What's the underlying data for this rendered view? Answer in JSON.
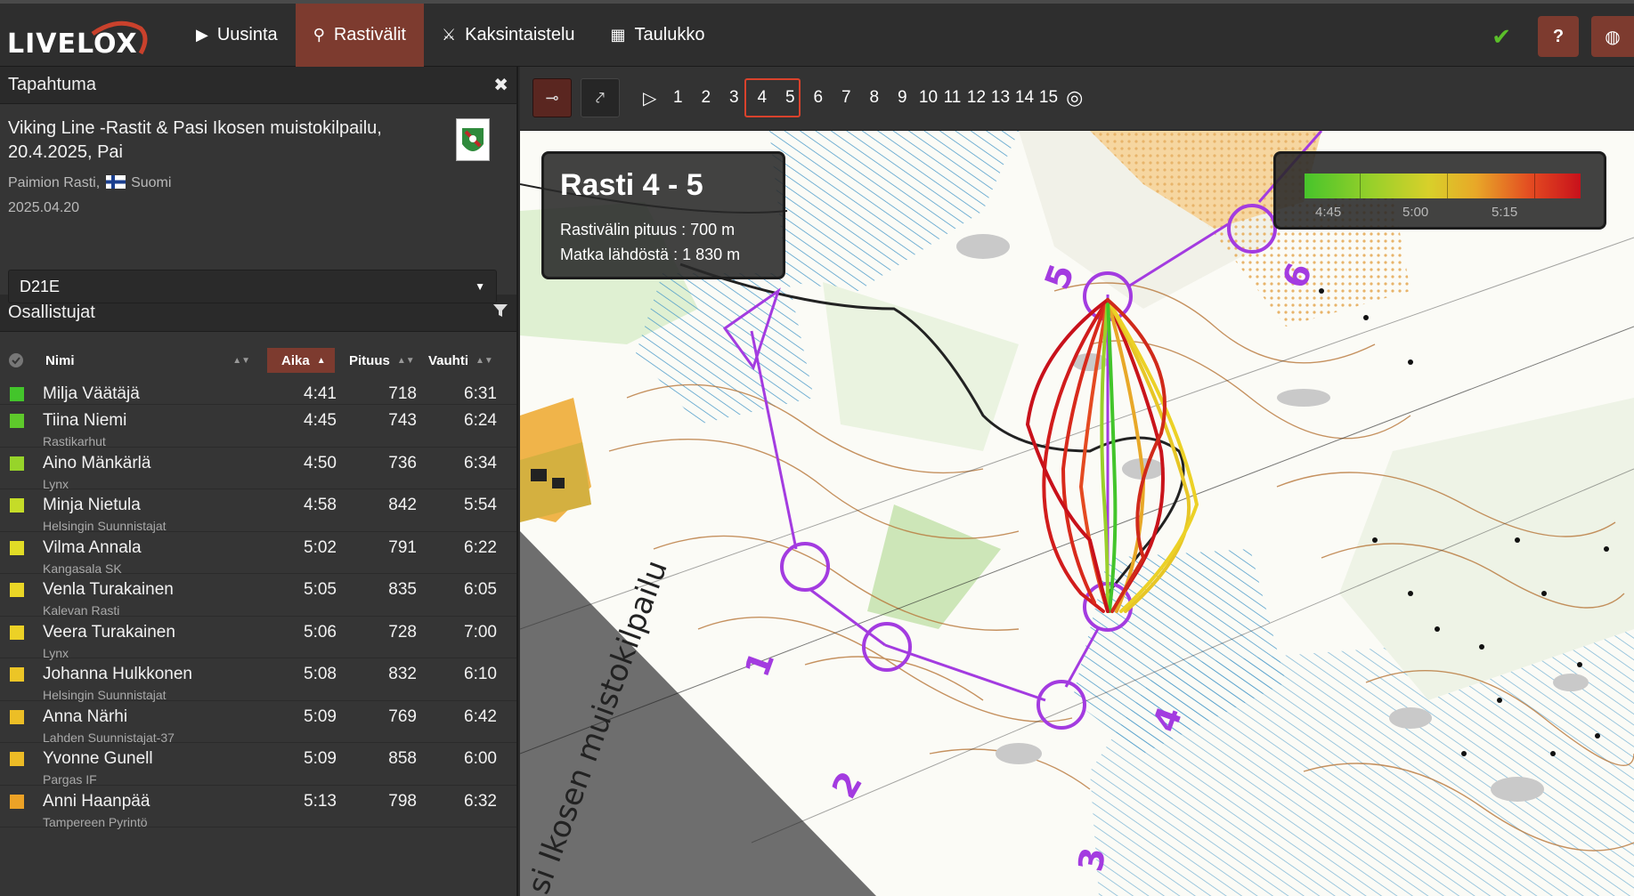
{
  "app": {
    "logo_text": "LIVELOX",
    "nav": [
      {
        "label": "Uusinta",
        "icon": "play-icon",
        "active": false
      },
      {
        "label": "Rastivälit",
        "icon": "route-icon",
        "active": true
      },
      {
        "label": "Kaksintaistelu",
        "icon": "swords-icon",
        "active": false
      },
      {
        "label": "Taulukko",
        "icon": "table-icon",
        "active": false
      }
    ],
    "help_label": "?"
  },
  "event_panel": {
    "header": "Tapahtuma",
    "title": "Viking Line -Rastit & Pasi Ikosen muistokilpailu, 20.4.2025, Pai",
    "organizer": "Paimion Rasti,",
    "country": "Suomi",
    "date": "2025.04.20",
    "class_selected": "D21E"
  },
  "participants": {
    "header": "Osallistujat",
    "columns": {
      "name": "Nimi",
      "time": "Aika",
      "length": "Pituus",
      "pace": "Vauhti"
    },
    "rows": [
      {
        "name": "Milja Väätäjä",
        "club": "",
        "time": "4:41",
        "length": "718",
        "pace": "6:31",
        "color": "#43c52b"
      },
      {
        "name": "Tiina Niemi",
        "club": "Rastikarhut",
        "time": "4:45",
        "length": "743",
        "pace": "6:24",
        "color": "#5ec92b"
      },
      {
        "name": "Aino Mänkärlä",
        "club": "Lynx",
        "time": "4:50",
        "length": "736",
        "pace": "6:34",
        "color": "#97d42a"
      },
      {
        "name": "Minja Nietula",
        "club": "Helsingin Suunnistajat",
        "time": "4:58",
        "length": "842",
        "pace": "5:54",
        "color": "#c5dc28"
      },
      {
        "name": "Vilma Annala",
        "club": "Kangasala SK",
        "time": "5:02",
        "length": "791",
        "pace": "6:22",
        "color": "#e1dc26"
      },
      {
        "name": "Venla Turakainen",
        "club": "Kalevan Rasti",
        "time": "5:05",
        "length": "835",
        "pace": "6:05",
        "color": "#ead626"
      },
      {
        "name": "Veera Turakainen",
        "club": "Lynx",
        "time": "5:06",
        "length": "728",
        "pace": "7:00",
        "color": "#ecd126"
      },
      {
        "name": "Johanna Hulkkonen",
        "club": "Helsingin Suunnistajat",
        "time": "5:08",
        "length": "832",
        "pace": "6:10",
        "color": "#ecc526"
      },
      {
        "name": "Anna Närhi",
        "club": "Lahden Suunnistajat-37",
        "time": "5:09",
        "length": "769",
        "pace": "6:42",
        "color": "#ecbe26"
      },
      {
        "name": "Yvonne Gunell",
        "club": "Pargas IF",
        "time": "5:09",
        "length": "858",
        "pace": "6:00",
        "color": "#ecbb26"
      },
      {
        "name": "Anni Haanpää",
        "club": "Tampereen Pyrintö",
        "time": "5:13",
        "length": "798",
        "pace": "6:32",
        "color": "#eca226"
      }
    ]
  },
  "legs": {
    "items": [
      "1",
      "2",
      "3",
      "4",
      "5",
      "6",
      "7",
      "8",
      "9",
      "10",
      "11",
      "12",
      "13",
      "14",
      "15"
    ],
    "selected": [
      "4",
      "5"
    ]
  },
  "map": {
    "info_title": "Rasti 4 - 5",
    "info_length": "Rastivälin pituus : 700 m",
    "info_distance": "Matka lähdöstä : 1 830 m",
    "scale_labels": [
      "4:45",
      "5:00",
      "5:15"
    ],
    "map_text": "si Ikosen muistokilpailu",
    "control_numbers": [
      "1",
      "2",
      "3",
      "4",
      "5",
      "6"
    ],
    "course_color": "#a33be0"
  }
}
